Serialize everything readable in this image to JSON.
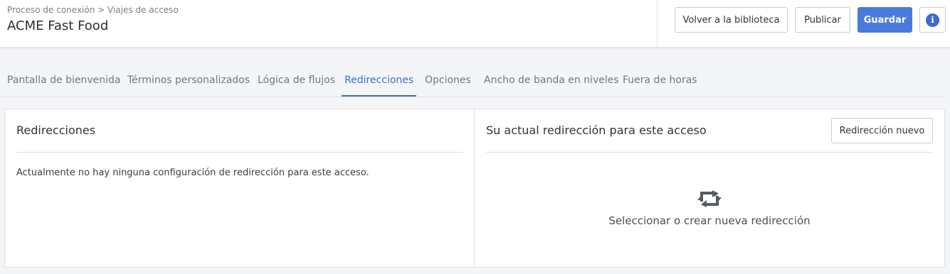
{
  "header": {
    "breadcrumb": "Proceso de conexión > Viajes de acceso",
    "title": "ACME Fast Food",
    "buttons": {
      "library": "Volver a la biblioteca",
      "publish": "Publicar",
      "save": "Guardar",
      "info_icon": "info-icon",
      "info_glyph": "i"
    },
    "accent_color": "#4a7bdc"
  },
  "tabs": [
    {
      "label": "Pantalla de bienvenida",
      "active": false
    },
    {
      "label": "Términos personalizados",
      "active": false
    },
    {
      "label": "Lógica de flujos",
      "active": false
    },
    {
      "label": "Redirecciones",
      "active": true
    },
    {
      "label": "Opciones",
      "active": false
    },
    {
      "label": "Ancho de banda en niveles",
      "active": false
    },
    {
      "label": "Fuera de horas",
      "active": false
    }
  ],
  "left_panel": {
    "title": "Redirecciones",
    "message": "Actualmente no hay ninguna configuración de redirección para este acceso."
  },
  "right_panel": {
    "title": "Su actual redirección para este acceso",
    "new_button": "Redirección nuevo",
    "empty_icon": "redirect-icon",
    "empty_text": "Seleccionar o crear nueva redirección"
  }
}
